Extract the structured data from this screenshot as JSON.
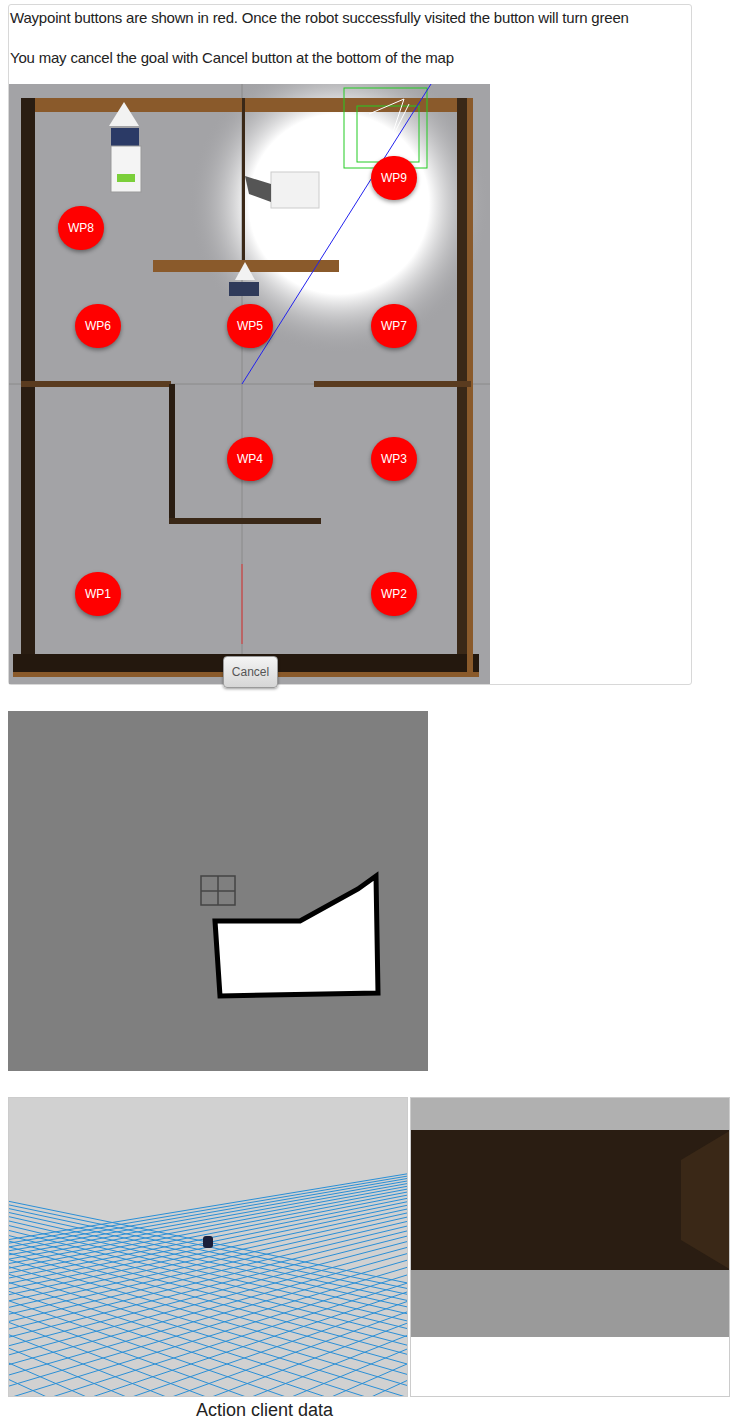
{
  "instructions": [
    "Waypoint buttons are shown in red. Once the robot successfully visited the button will turn green",
    "You may cancel the goal with Cancel button at the bottom of the map"
  ],
  "waypoints": [
    {
      "label": "WP9",
      "visited": false
    },
    {
      "label": "WP8",
      "visited": false
    },
    {
      "label": "WP6",
      "visited": false
    },
    {
      "label": "WP5",
      "visited": false
    },
    {
      "label": "WP7",
      "visited": false
    },
    {
      "label": "WP4",
      "visited": false
    },
    {
      "label": "WP3",
      "visited": false
    },
    {
      "label": "WP1",
      "visited": false
    },
    {
      "label": "WP2",
      "visited": false
    }
  ],
  "cancel_button": "Cancel",
  "caption": "Action client data"
}
